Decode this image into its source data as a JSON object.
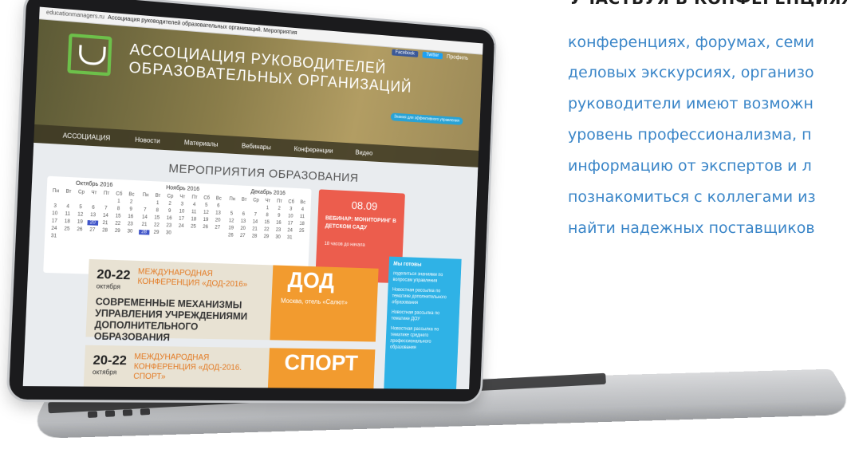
{
  "side_text": {
    "heading": "УЧАСТВУЯ В КОНФЕРЕНЦИЯХ,",
    "lines": [
      "конференциях, форумах, семи",
      "деловых экскурсиях, организо",
      "руководители имеют возможн",
      "уровень профессионализма, п",
      "информацию от экспертов и л",
      "познакомиться с коллегами из",
      "найти надежных поставщиков"
    ]
  },
  "browser": {
    "url": "educationmanagers.ru",
    "title": "Ассоциация руководителей образовательных организаций. Мероприятия"
  },
  "site": {
    "org_line1": "АССОЦИАЦИЯ РУКОВОДИТЕЛЕЙ",
    "org_line2": "ОБРАЗОВАТЕЛЬНЫХ ОРГАНИЗАЦИЙ",
    "social_fb": "Facebook",
    "social_tw": "Twitter",
    "profile": "Профиль",
    "badge": "Знания для эффективного управления",
    "nav": [
      "АССОЦИАЦИЯ",
      "Новости",
      "Материалы",
      "Вебинары",
      "Конференции",
      "Видео"
    ],
    "section_title": "МЕРОПРИЯТИЯ ОБРАЗОВАНИЯ"
  },
  "calendar": {
    "months": [
      "Октябрь 2016",
      "Ноябрь 2016",
      "Декабрь 2016"
    ],
    "weekdays": [
      "Пн",
      "Вт",
      "Ср",
      "Чт",
      "Пт",
      "Сб",
      "Вс"
    ]
  },
  "event": {
    "date": "08.09",
    "name": "ВЕБИНАР: МОНИТОРИНГ В ДЕТСКОМ САДУ",
    "time": "18 часов до начала"
  },
  "banner1": {
    "date": "20-22",
    "month": "октября",
    "conf": "МЕЖДУНАРОДНАЯ КОНФЕРЕНЦИЯ «ДОД-2016»",
    "title": "СОВРЕМЕННЫЕ МЕХАНИЗМЫ УПРАВЛЕНИЯ УЧРЕЖДЕНИЯМИ ДОПОЛНИТЕЛЬНОГО ОБРАЗОВАНИЯ",
    "tag": "ДОД",
    "place": "Москва, отель «Салют»"
  },
  "banner2": {
    "date": "20-22",
    "month": "октября",
    "conf": "МЕЖДУНАРОДНАЯ КОНФЕРЕНЦИЯ «ДОД-2016. СПОРТ»",
    "tag": "СПОРТ"
  },
  "sidebar": {
    "title": "Мы готовы",
    "items": [
      "поделиться знаниями по вопросам управления",
      "Новостная рассылка по тематике дополнительного образования",
      "Новостная рассылка по тематике ДОУ",
      "Новостная рассылка по тематике среднего профессионального образования"
    ]
  }
}
